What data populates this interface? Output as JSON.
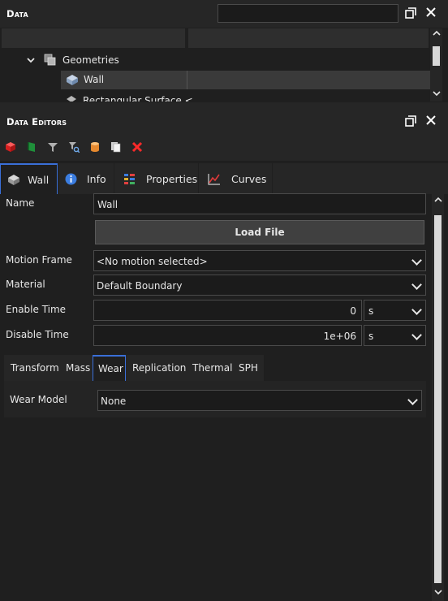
{
  "data_panel": {
    "title": "Data",
    "search_value": "",
    "tree": {
      "geometries_label": "Geometries",
      "wall_label": "Wall",
      "partial_item_label": "Rectangular Surface <"
    }
  },
  "editors_panel": {
    "title": "Data Editors",
    "toolbar_icons": [
      "red-cube-icon",
      "green-flag-icon",
      "funnel-icon",
      "search-filter-icon",
      "cylinder-icon",
      "copy-icon",
      "delete-icon"
    ],
    "tabs": [
      {
        "label": "Wall",
        "icon": "wall-icon"
      },
      {
        "label": "Info",
        "icon": "info-icon"
      },
      {
        "label": "Properties",
        "icon": "properties-icon"
      },
      {
        "label": "Curves",
        "icon": "curves-icon"
      }
    ],
    "form": {
      "name_label": "Name",
      "name_value": "Wall",
      "load_file_label": "Load File",
      "motion_frame_label": "Motion Frame",
      "motion_frame_value": "<No motion selected>",
      "material_label": "Material",
      "material_value": "Default Boundary",
      "enable_time_label": "Enable Time",
      "enable_time_value": "0",
      "enable_time_unit": "s",
      "disable_time_label": "Disable Time",
      "disable_time_value": "1e+06",
      "disable_time_unit": "s"
    },
    "sub_tabs": [
      "Transform",
      "Mass",
      "Wear",
      "Replication",
      "Thermal",
      "SPH"
    ],
    "wear": {
      "model_label": "Wear Model",
      "model_value": "None"
    }
  },
  "colors": {
    "accent": "#3a6fd8",
    "panel_bg": "#262626",
    "field_bg": "#1b1b1b"
  }
}
